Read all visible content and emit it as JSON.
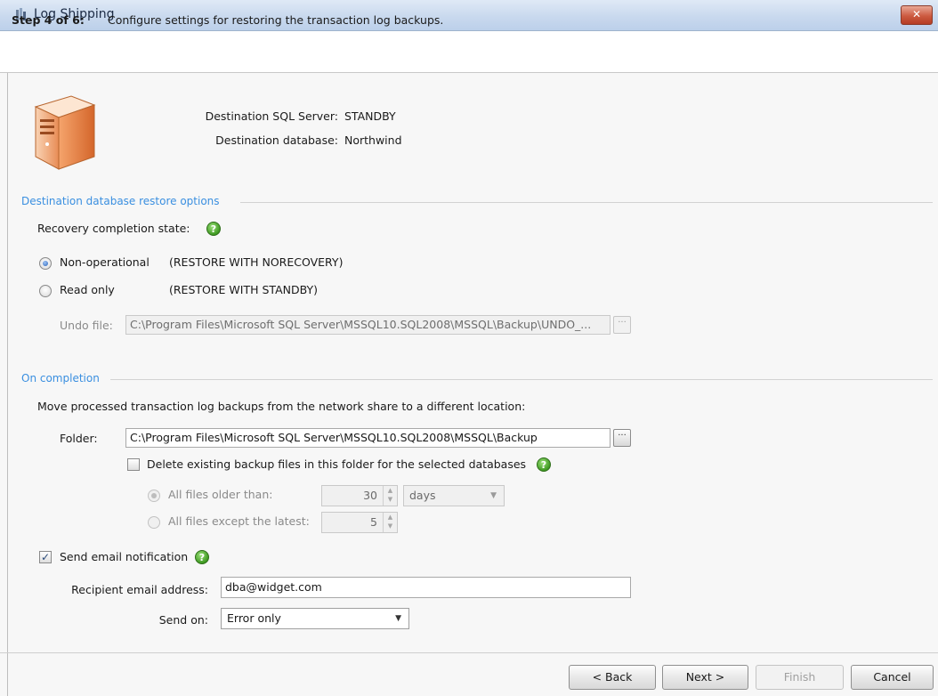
{
  "window": {
    "title": "Log Shipping",
    "close_symbol": "✕"
  },
  "step": {
    "label": "Step 4 of 6:",
    "description": "Configure settings for restoring the transaction log backups."
  },
  "destination": {
    "server_label": "Destination SQL Server:",
    "server_value": "STANDBY",
    "database_label": "Destination database:",
    "database_value": "Northwind"
  },
  "restore_options": {
    "section_title": "Destination database restore options",
    "recovery_label": "Recovery completion state:",
    "help_symbol": "?",
    "options": [
      {
        "label": "Non-operational",
        "detail": "(RESTORE WITH NORECOVERY)",
        "selected": true
      },
      {
        "label": "Read only",
        "detail": "(RESTORE WITH STANDBY)",
        "selected": false
      }
    ],
    "undo_file_label": "Undo file:",
    "undo_file_value": "C:\\Program Files\\Microsoft SQL Server\\MSSQL10.SQL2008\\MSSQL\\Backup\\UNDO_..."
  },
  "completion": {
    "section_title": "On completion",
    "move_label": "Move processed transaction log backups from the network share to a different location:",
    "folder_label": "Folder:",
    "folder_value": "C:\\Program Files\\Microsoft SQL Server\\MSSQL10.SQL2008\\MSSQL\\Backup",
    "delete_label": "Delete existing backup files in this folder for the selected databases",
    "delete_checked": false,
    "older_than_label": "All files older than:",
    "older_than_value": "30",
    "older_than_unit": "days",
    "except_latest_label": "All files except the latest:",
    "except_latest_value": "5"
  },
  "email": {
    "send_label": "Send email notification",
    "send_checked": true,
    "check_symbol": "✓",
    "recipient_label": "Recipient email address:",
    "recipient_value": "dba@widget.com",
    "send_on_label": "Send on:",
    "send_on_value": "Error only"
  },
  "buttons": {
    "back": "< Back",
    "next": "Next >",
    "finish": "Finish",
    "cancel": "Cancel"
  },
  "icons": {
    "app": "log-shipping-icon",
    "server": "server-icon",
    "help": "help-icon",
    "browse_dots": "···",
    "spin_up": "▲",
    "spin_down": "▼",
    "dropdown": "▼"
  },
  "colors": {
    "section_title": "#3a8fe0",
    "help_green": "#3f9a22",
    "titlebar": "#c9d9ee"
  }
}
